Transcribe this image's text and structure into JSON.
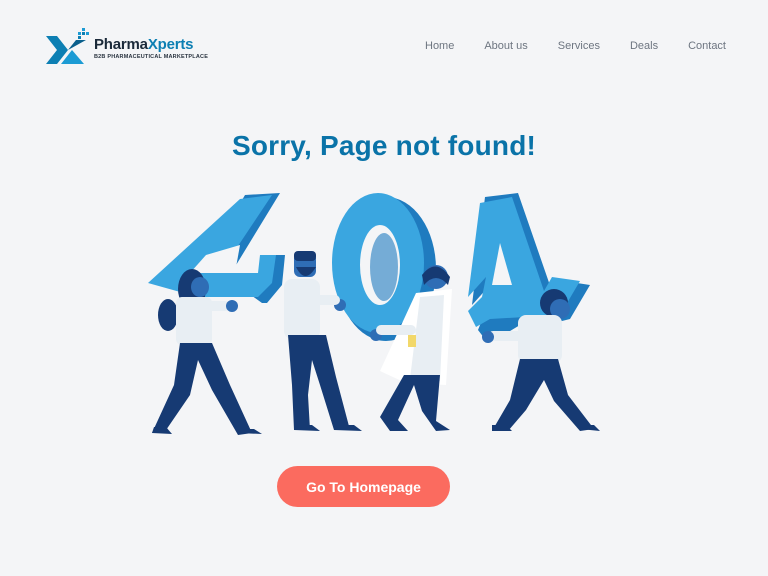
{
  "brand": {
    "name_part1": "Pharma",
    "name_part2": "Xperts",
    "tagline": "B2B PHARMACEUTICAL MARKETPLACE",
    "logo_icon": "x-logo-icon",
    "primary_color": "#0d7fb3",
    "dark_color": "#1b2a3a"
  },
  "nav": {
    "items": [
      {
        "label": "Home"
      },
      {
        "label": "About us"
      },
      {
        "label": "Services"
      },
      {
        "label": "Deals"
      },
      {
        "label": "Contact"
      }
    ]
  },
  "error": {
    "title": "Sorry, Page not found!",
    "title_color": "#0a73a8",
    "code": "404"
  },
  "cta": {
    "label": "Go To Homepage",
    "color": "#fb6b5f"
  },
  "colors": {
    "background": "#f4f5f7",
    "digit_light": "#3aa6e0",
    "digit_dark": "#1f7bbf",
    "pants": "#163a73",
    "shirt": "#e8eef3"
  }
}
